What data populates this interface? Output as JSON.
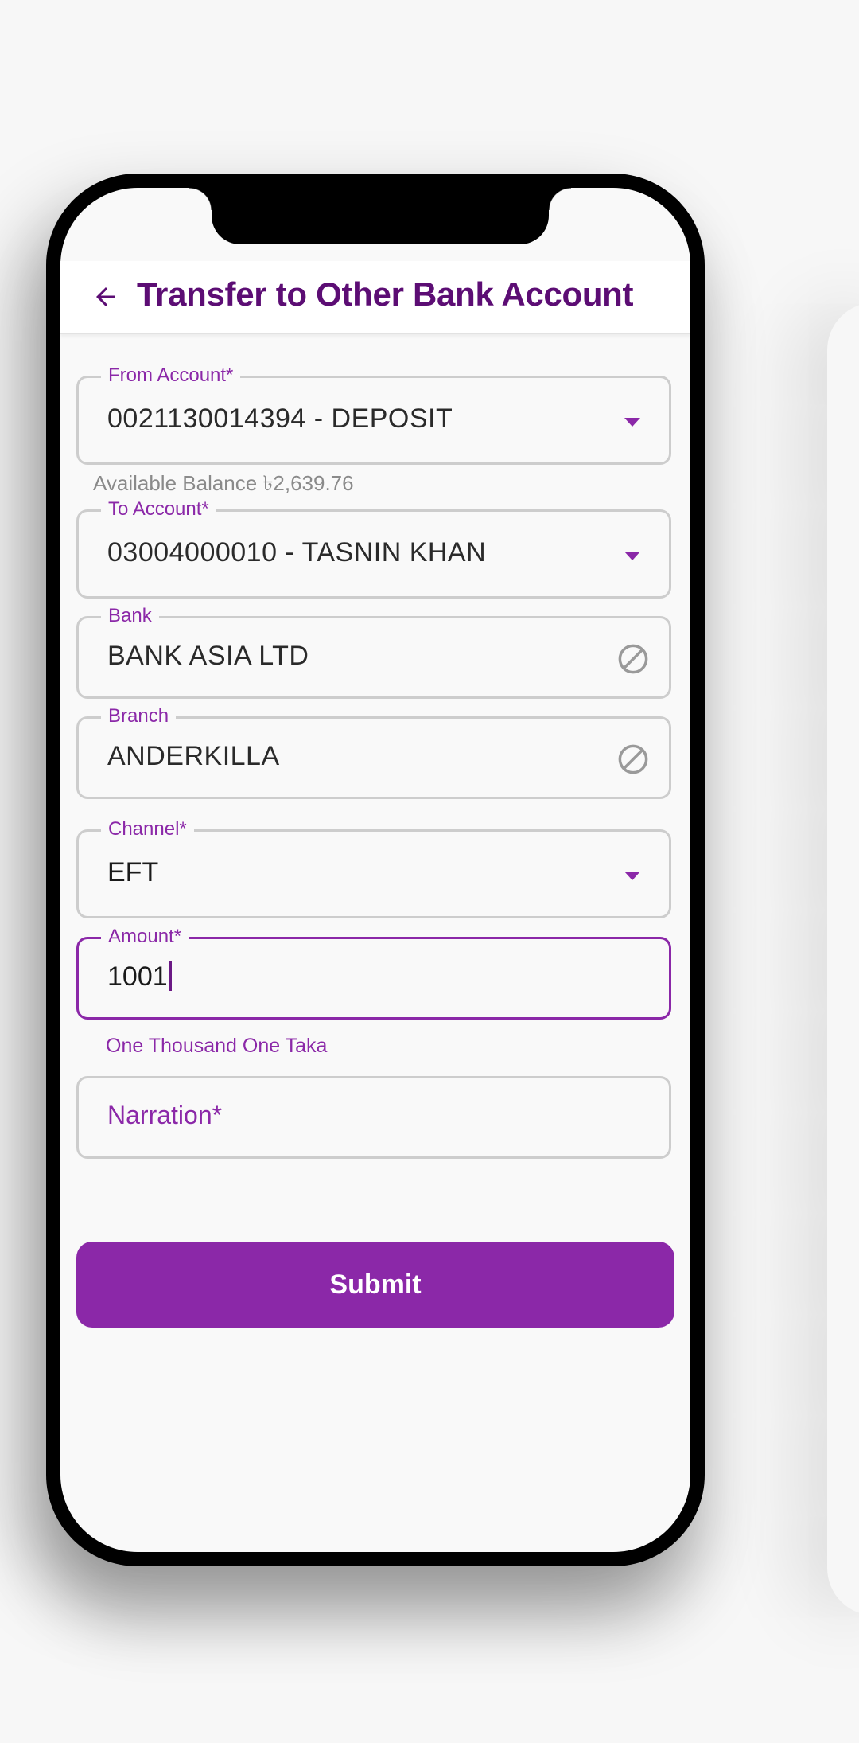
{
  "app": {
    "title": "Transfer to Other Bank Account"
  },
  "form": {
    "from_account": {
      "label": "From Account*",
      "value": "0021130014394 - DEPOSIT",
      "helper": "Available Balance ৳2,639.76"
    },
    "to_account": {
      "label": "To Account*",
      "value": "03004000010 - TASNIN KHAN"
    },
    "bank": {
      "label": "Bank",
      "value": "BANK ASIA LTD"
    },
    "branch": {
      "label": "Branch",
      "value": "ANDERKILLA"
    },
    "channel": {
      "label": "Channel*",
      "value": "EFT"
    },
    "amount": {
      "label": "Amount*",
      "value": "1001",
      "helper": "One Thousand One Taka"
    },
    "narration": {
      "placeholder": "Narration*"
    },
    "submit_label": "Submit"
  },
  "colors": {
    "brand": "#8b28a8",
    "title": "#5c0d74",
    "border": "#cdcdcd",
    "helper_grey": "#8a8a8a"
  },
  "icons": {
    "back": "arrow-left-icon",
    "dropdown": "caret-down-icon",
    "disabled": "block-icon"
  }
}
